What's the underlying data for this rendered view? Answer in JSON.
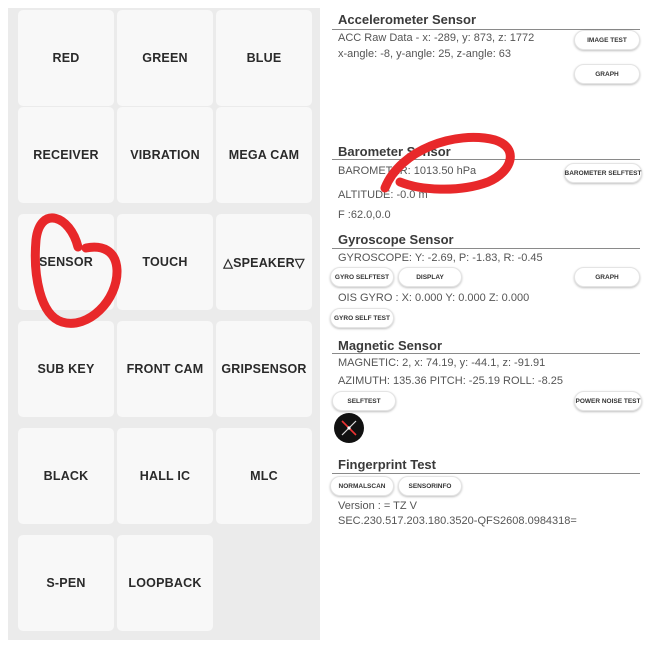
{
  "left_grid": {
    "buttons": [
      "RED",
      "GREEN",
      "BLUE",
      "RECEIVER",
      "VIBRATION",
      "MEGA CAM",
      "SENSOR",
      "TOUCH",
      "△SPEAKER▽",
      "SUB KEY",
      "FRONT CAM",
      "GRIPSENSOR",
      "BLACK",
      "HALL IC",
      "MLC",
      "S-PEN",
      "LOOPBACK"
    ]
  },
  "accelerometer": {
    "title": "Accelerometer Sensor",
    "raw": "ACC Raw Data - x: -289, y: 873, z: 1772",
    "angle": "x-angle: -8, y-angle: 25, z-angle: 63",
    "image_test_label": "IMAGE TEST",
    "graph_label": "GRAPH"
  },
  "barometer": {
    "title": "Barometer Sensor",
    "value": "BAROMETER: 1013.50 hPa",
    "altitude": "ALTITUDE: -0.0 m",
    "f": "F :62.0,0.0",
    "selftest_label": "BAROMETER SELFTEST"
  },
  "gyroscope": {
    "title": "Gyroscope Sensor",
    "value": "GYROSCOPE: Y: -2.69, P: -1.83, R: -0.45",
    "selftest_label": "GYRO SELFTEST",
    "display_label": "DISPLAY",
    "graph_label": "GRAPH",
    "ois": "OIS GYRO : X: 0.000 Y: 0.000 Z: 0.000",
    "self_test_label": "GYRO SELF TEST"
  },
  "magnetic": {
    "title": "Magnetic Sensor",
    "value": "MAGNETIC: 2, x: 74.19, y: -44.1, z: -91.91",
    "azimuth": "AZIMUTH: 135.36   PITCH: -25.19   ROLL: -8.25",
    "selftest_label": "SELFTEST",
    "power_noise_label": "POWER NOISE TEST"
  },
  "fingerprint": {
    "title": "Fingerprint Test",
    "normalscan_label": "NORMALSCAN",
    "sensorinfo_label": "SENSORINFO",
    "version": "Version : = TZ V",
    "sec": "SEC.230.517.203.180.3520-QFS2608.0984318="
  },
  "colors": {
    "annotation": "#e8282a",
    "left_bg": "#ebebeb",
    "tile_bg": "#f8f8f8",
    "rule": "#8a8a8a"
  }
}
